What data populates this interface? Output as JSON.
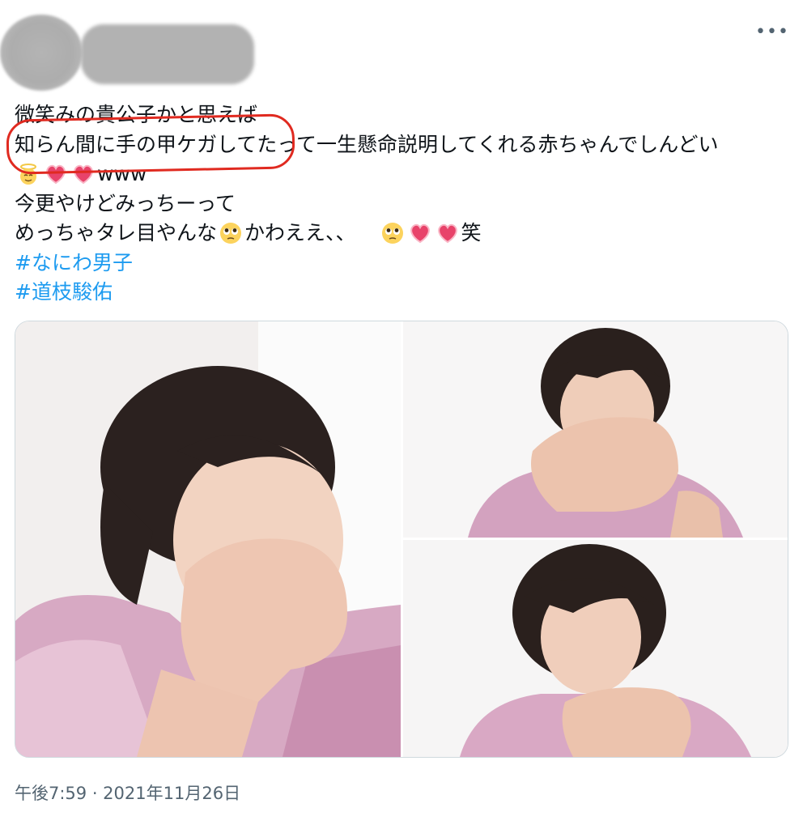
{
  "tweet": {
    "more_label": "•••",
    "lines": {
      "l1": "微笑みの貴公子かと思えば",
      "l2": "知らん間に手の甲ケガしてたって一生懸命説明してくれる赤ちゃんでしんどい",
      "l3_text": "www",
      "l4": "今更やけどみっちーって",
      "l5_a": "めっちゃタレ目やんな",
      "l5_b": "かわええ、、",
      "l5_c": "笑"
    },
    "hashtags": [
      "#なにわ男子",
      "#道枝駿佑"
    ],
    "timestamp": "午後7:59 · 2021年11月26日"
  },
  "colors": {
    "hashtag": "#1d9bf0",
    "annotation": "#e02a20",
    "meta_text": "#536471",
    "border": "#cfd9de"
  },
  "icons": {
    "more": "more-dots-icon",
    "emoji_angel": "angel-face-emoji-icon",
    "emoji_heart": "pink-heart-emoji-icon",
    "emoji_pleading": "pleading-face-emoji-icon"
  }
}
